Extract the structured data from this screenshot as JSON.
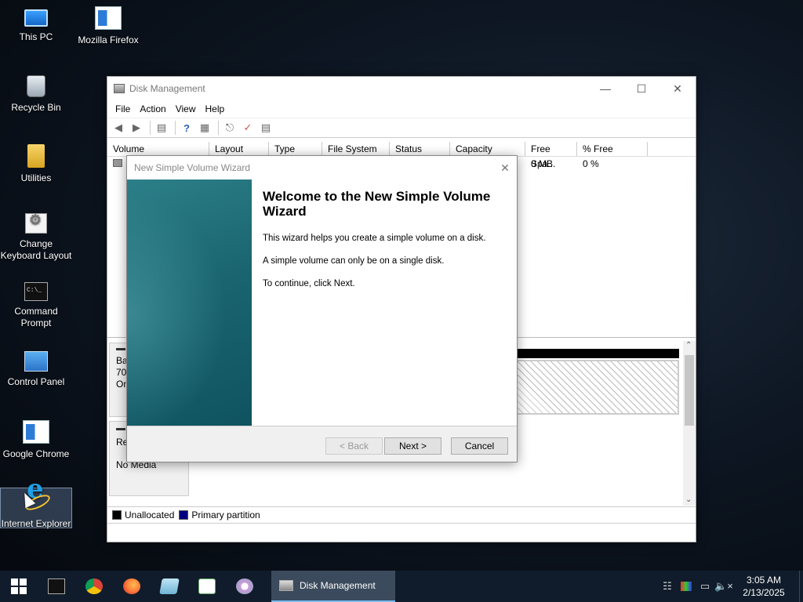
{
  "desktop": {
    "icons": [
      {
        "label": "This PC"
      },
      {
        "label": "Mozilla Firefox"
      },
      {
        "label": "Recycle Bin"
      },
      {
        "label": "Utilities"
      },
      {
        "label": "Change Keyboard Layout"
      },
      {
        "label": "Command Prompt"
      },
      {
        "label": "Control Panel"
      },
      {
        "label": "Google Chrome"
      },
      {
        "label": "Internet Explorer"
      }
    ]
  },
  "disk_management": {
    "title": "Disk Management",
    "menu": [
      "File",
      "Action",
      "View",
      "Help"
    ],
    "columns": [
      "Volume",
      "Layout",
      "Type",
      "File System",
      "Status",
      "Capacity",
      "Free Spa...",
      "% Free"
    ],
    "row": {
      "free_space": "0 MB",
      "percent_free": "0 %"
    },
    "disk0": {
      "line1": "Bas",
      "line2": "70.",
      "line3": "On"
    },
    "disk1": {
      "line1": "Re",
      "line2": "No Media"
    },
    "legend": [
      {
        "label": "Unallocated",
        "color": "#000000"
      },
      {
        "label": "Primary partition",
        "color": "#000080"
      }
    ]
  },
  "wizard": {
    "title": "New Simple Volume Wizard",
    "heading": "Welcome to the New Simple Volume Wizard",
    "para1": "This wizard helps you create a simple volume on a disk.",
    "para2": "A simple volume can only be on a single disk.",
    "para3": "To continue, click Next.",
    "back_label": "< Back",
    "next_label": "Next >",
    "cancel_label": "Cancel"
  },
  "taskbar": {
    "active_app": "Disk Management",
    "time": "3:05 AM",
    "date": "2/13/2025"
  }
}
